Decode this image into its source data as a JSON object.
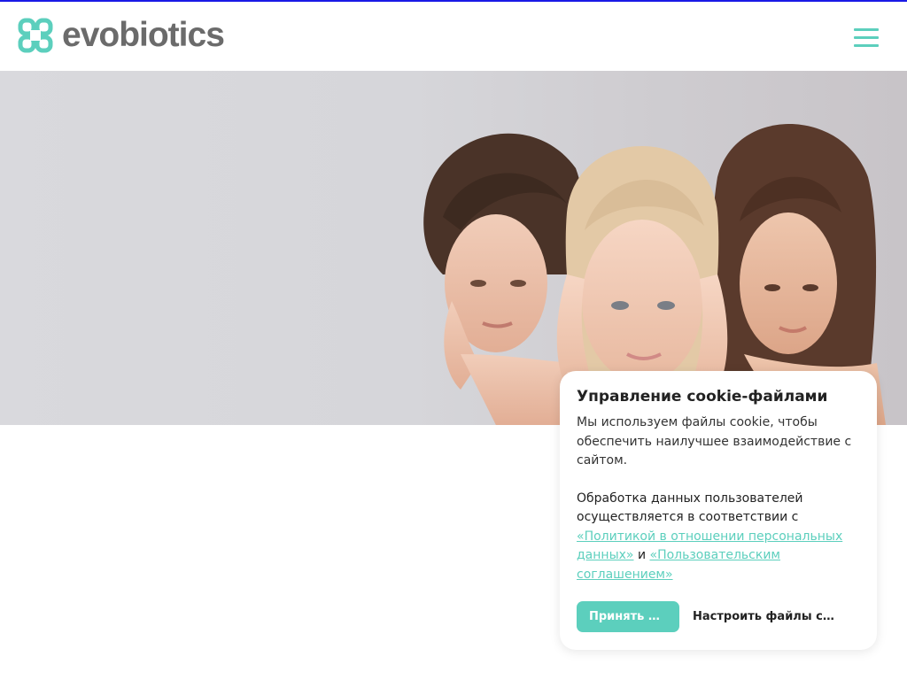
{
  "brand": {
    "name": "evobiotics",
    "accent_color": "#5ccfbd",
    "text_color": "#6b6b6b"
  },
  "header": {
    "menu_icon": "hamburger-menu-icon"
  },
  "hero": {
    "image": "photo of three women of different ages touching their faces"
  },
  "cookie_banner": {
    "title": "Управление cookie-файлами",
    "text": "Мы используем файлы cookie, чтобы обеспечить наилучшее взаимодействие с сайтом.",
    "policy_prefix": "Обработка данных пользователей осуществляется в соответствии с",
    "policy_link": "«Политикой в отношении персональных данных»",
    "conjunction": "и",
    "agreement_link": "«Пользовательским соглашением»",
    "accept_label": "Принять все",
    "settings_label": "Настроить файлы cookie"
  }
}
